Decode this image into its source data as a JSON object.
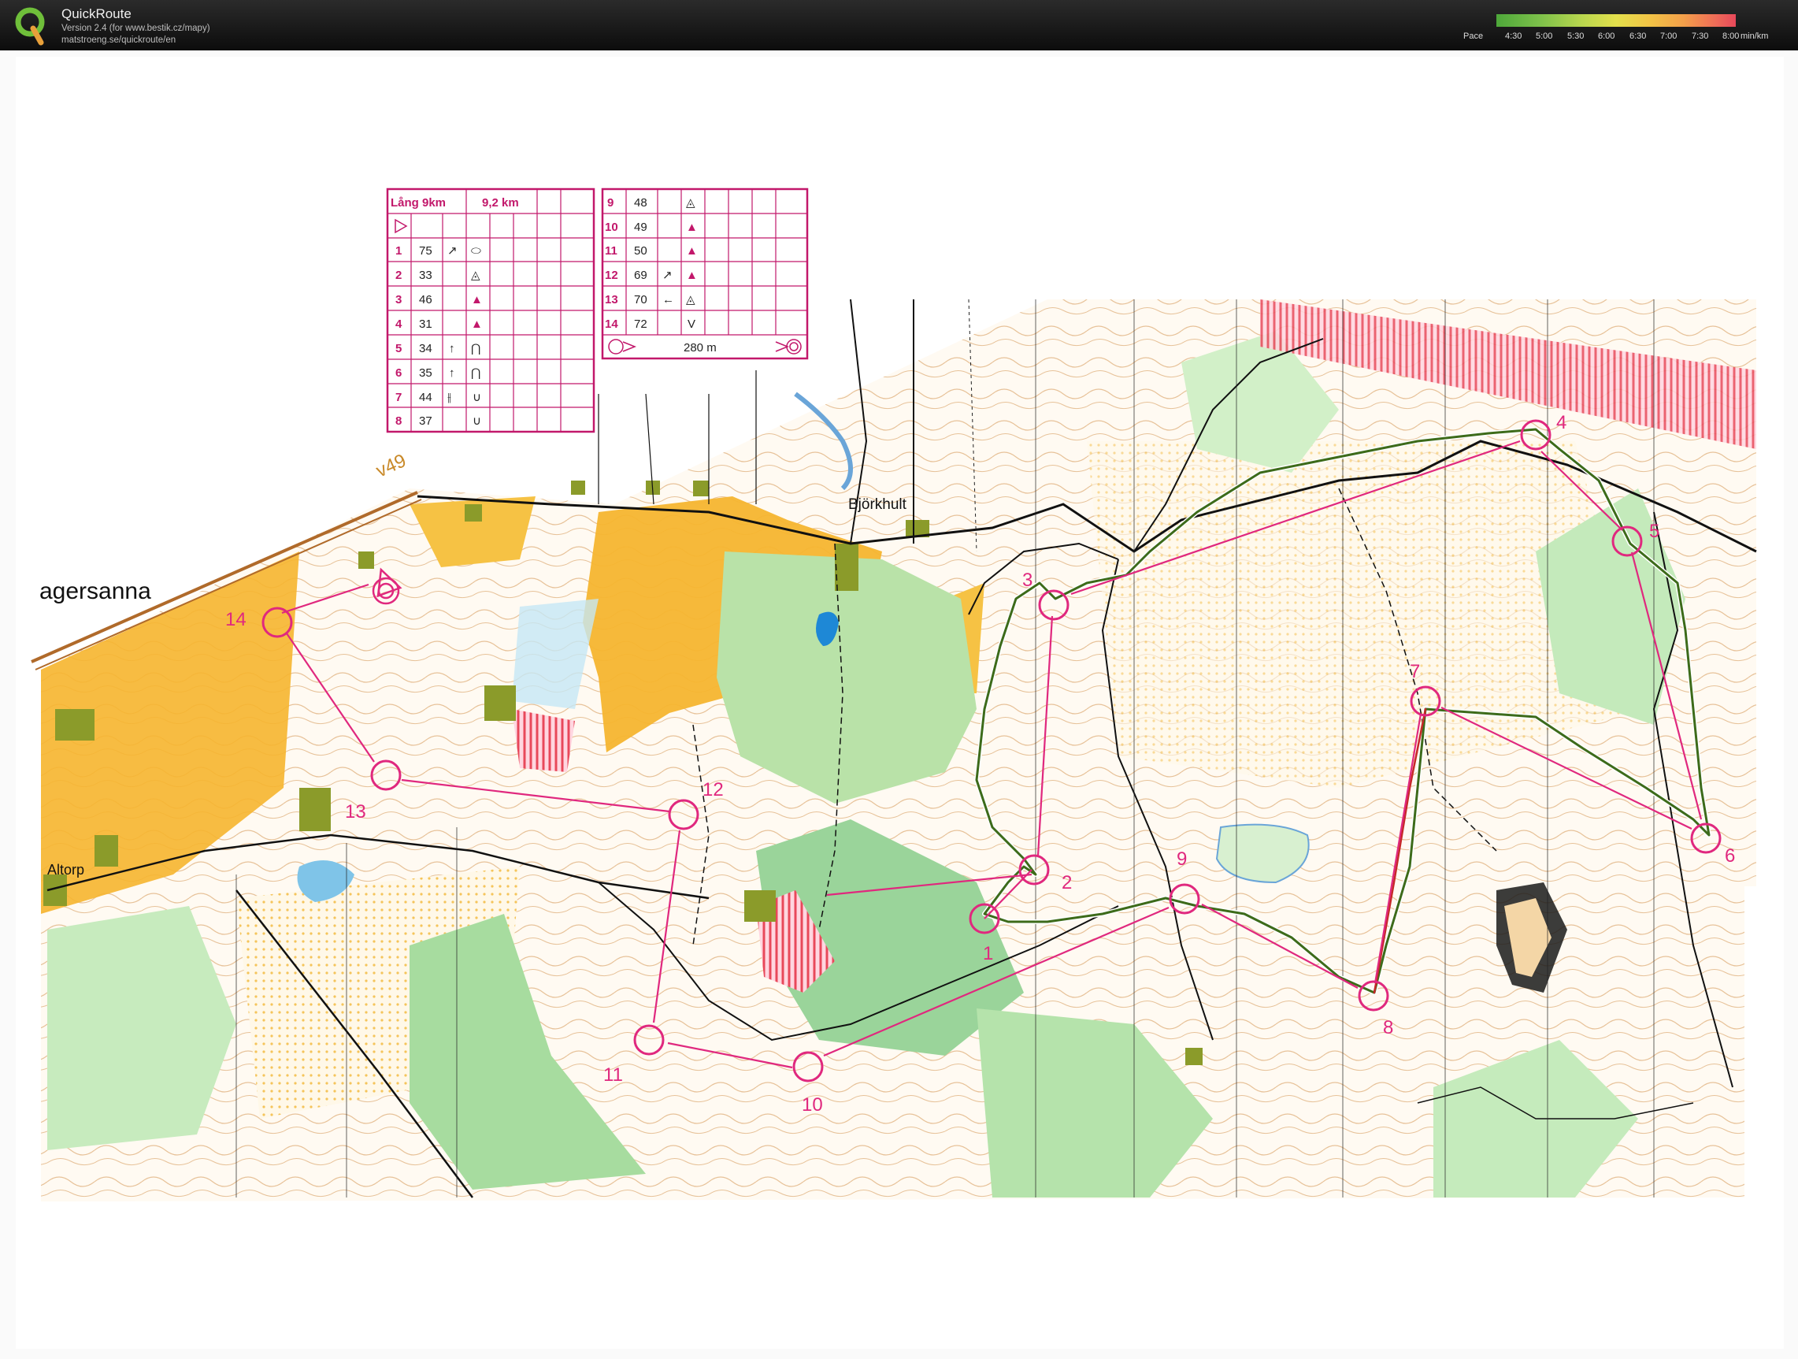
{
  "header": {
    "app_name": "QuickRoute",
    "version": "Version 2.4  (for www.bestik.cz/mapy)",
    "url": "matstroeng.se/quickroute/en",
    "pace_label": "Pace",
    "pace_ticks": [
      "4:30",
      "5:00",
      "5:30",
      "6:00",
      "6:30",
      "7:00",
      "7:30",
      "8:00"
    ],
    "pace_unit": "min/km",
    "pace_colors": [
      "#4ea83a",
      "#7cc04a",
      "#b7d64e",
      "#e3e04c",
      "#f2c446",
      "#f3a04a",
      "#ee6a58",
      "#e8485a"
    ]
  },
  "map": {
    "place_names": {
      "agersanna": "agersanna",
      "bjorkhult": "Björkhult",
      "altorp": "Altorp",
      "road": "v49"
    },
    "course_color": "#e0287e",
    "route_color": "#3d6b1a",
    "controls": [
      "1",
      "2",
      "3",
      "4",
      "5",
      "6",
      "7",
      "8",
      "9",
      "10",
      "11",
      "12",
      "13",
      "14"
    ],
    "description_sheet": {
      "left": {
        "title": "Lång  9km",
        "distance": "9,2 km",
        "rows": [
          {
            "n": "1",
            "code": "75",
            "dir": "↗",
            "symbol": "⬭"
          },
          {
            "n": "2",
            "code": "33",
            "dir": "",
            "symbol": "◬"
          },
          {
            "n": "3",
            "code": "46",
            "dir": "",
            "symbol": "▲"
          },
          {
            "n": "4",
            "code": "31",
            "dir": "",
            "symbol": "▲"
          },
          {
            "n": "5",
            "code": "34",
            "dir": "↑",
            "symbol": "⋂"
          },
          {
            "n": "6",
            "code": "35",
            "dir": "↑",
            "symbol": "⋂"
          },
          {
            "n": "7",
            "code": "44",
            "dir": "⫲",
            "symbol": "∪"
          },
          {
            "n": "8",
            "code": "37",
            "dir": "",
            "symbol": "∪"
          }
        ]
      },
      "right": {
        "rows": [
          {
            "n": "9",
            "code": "48",
            "dir": "",
            "symbol": "◬"
          },
          {
            "n": "10",
            "code": "49",
            "dir": "",
            "symbol": "▲"
          },
          {
            "n": "11",
            "code": "50",
            "dir": "",
            "symbol": "▲"
          },
          {
            "n": "12",
            "code": "69",
            "dir": "↗",
            "symbol": "▲"
          },
          {
            "n": "13",
            "code": "70",
            "dir": "←",
            "symbol": "◬"
          },
          {
            "n": "14",
            "code": "72",
            "dir": "",
            "symbol": "V"
          }
        ],
        "finish_distance": "280 m"
      }
    }
  }
}
